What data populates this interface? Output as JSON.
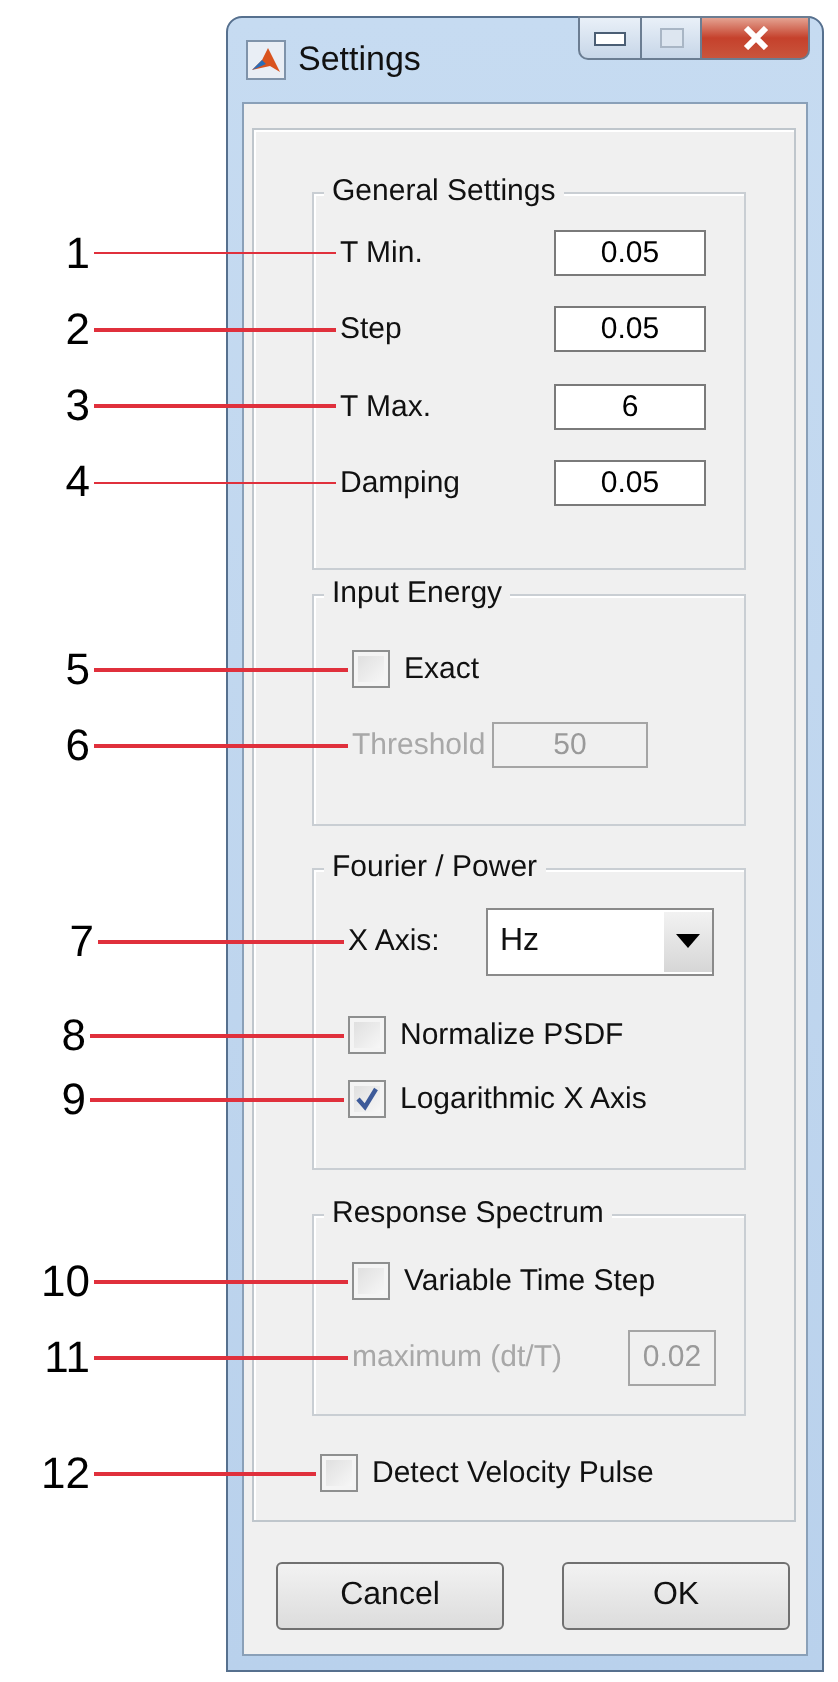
{
  "window": {
    "title": "Settings"
  },
  "general": {
    "title": "General Settings",
    "fields": [
      {
        "callout": "1",
        "label": "T Min.",
        "value": "0.05"
      },
      {
        "callout": "2",
        "label": "Step",
        "value": "0.05"
      },
      {
        "callout": "3",
        "label": "T Max.",
        "value": "6"
      },
      {
        "callout": "4",
        "label": "Damping",
        "value": "0.05"
      }
    ]
  },
  "input_energy": {
    "title": "Input Energy",
    "exact": {
      "callout": "5",
      "label": "Exact",
      "checked": false
    },
    "threshold": {
      "callout": "6",
      "label": "Threshold",
      "value": "50",
      "disabled": true
    }
  },
  "fourier": {
    "title": "Fourier / Power",
    "x_axis": {
      "callout": "7",
      "label": "X Axis:",
      "value": "Hz"
    },
    "checkboxes": [
      {
        "callout": "8",
        "label": "Normalize PSDF",
        "checked": false
      },
      {
        "callout": "9",
        "label": "Logarithmic X Axis",
        "checked": true
      }
    ]
  },
  "response_spectrum": {
    "title": "Response Spectrum",
    "variable_step": {
      "callout": "10",
      "label": "Variable Time Step",
      "checked": false
    },
    "maximum": {
      "callout": "11",
      "label": "maximum (dt/T)",
      "value": "0.02",
      "disabled": true
    }
  },
  "velocity_pulse": {
    "callout": "12",
    "label": "Detect Velocity Pulse",
    "checked": false
  },
  "buttons": [
    "Cancel",
    "OK"
  ]
}
